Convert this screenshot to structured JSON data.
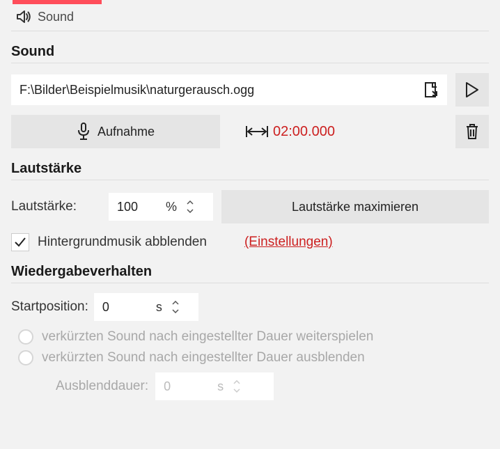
{
  "tab": {
    "label": "Sound"
  },
  "sound": {
    "heading": "Sound",
    "file_path": "F:\\Bilder\\Beispielmusik\\naturgerausch.ogg",
    "record_label": "Aufnahme",
    "duration": "02:00.000"
  },
  "volume": {
    "heading": "Lautstärke",
    "label": "Lautstärke:",
    "value": "100",
    "unit": "%",
    "maximize_label": "Lautstärke maximieren",
    "dim_bg_label": "Hintergrundmusik abblenden",
    "settings_link": "(Einstellungen)"
  },
  "playback": {
    "heading": "Wiedergabeverhalten",
    "start_label": "Startposition:",
    "start_value": "0",
    "start_unit": "s",
    "radio1_label": "verkürzten Sound nach eingestellter Dauer weiterspielen",
    "radio2_label": "verkürzten Sound nach eingestellter Dauer ausblenden",
    "fade_label": "Ausblenddauer:",
    "fade_value": "0",
    "fade_unit": "s"
  }
}
